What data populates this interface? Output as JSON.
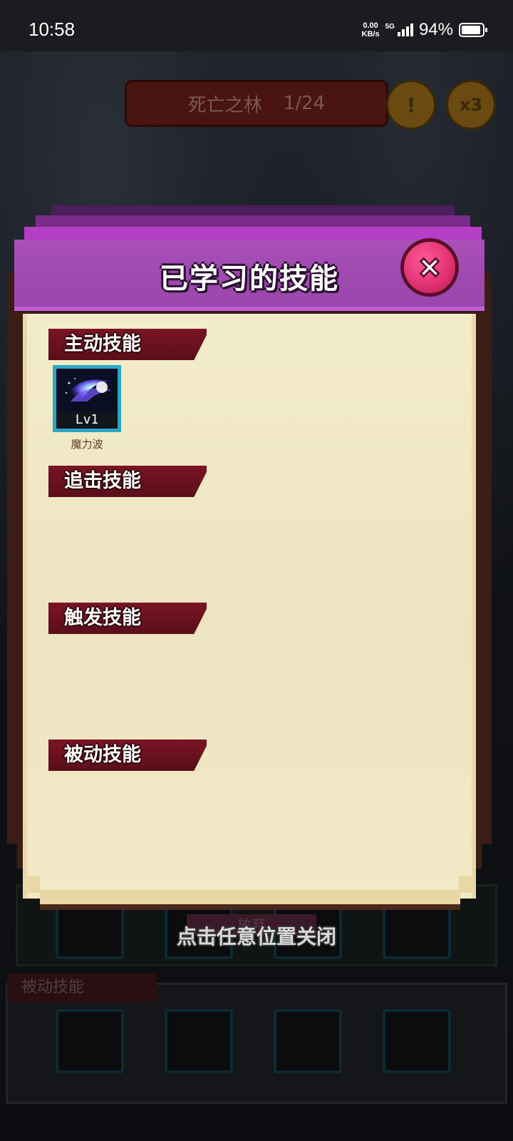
{
  "status_bar": {
    "time": "10:58",
    "net_speed_value": "0.00",
    "net_speed_unit": "KB/s",
    "net_type": "5G",
    "battery_percent": "94%",
    "battery_level": 0.94
  },
  "background": {
    "stage_name": "死亡之林",
    "stage_progress": "1/24",
    "alert_icon": "exclamation-icon",
    "speed_label": "x3",
    "mid_tag_label": "放弃",
    "bottom_tag_label": "被动技能"
  },
  "modal": {
    "title": "已学习的技能",
    "close_icon": "close-icon",
    "sections": {
      "active": "主动技能",
      "chase": "追击技能",
      "trigger": "触发技能",
      "passive": "被动技能"
    },
    "active_skills": [
      {
        "icon": "magic-wave-icon",
        "level": "Lv1",
        "name": "魔力波"
      }
    ],
    "colors": {
      "header": "#a84fb8",
      "body": "#f0e8c6",
      "section_tag": "#6a1020",
      "close_button": "#e0306e",
      "skill_frame": "#2aa6c4"
    }
  },
  "close_hint": "点击任意位置关闭"
}
